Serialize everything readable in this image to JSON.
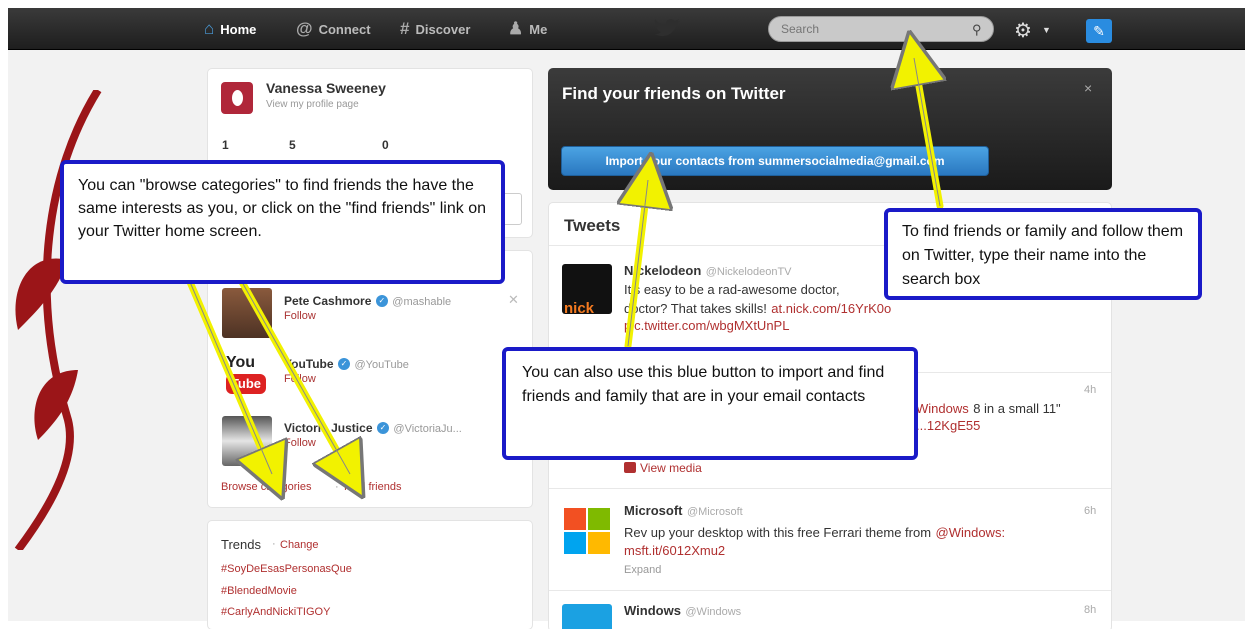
{
  "topbar": {
    "nav": [
      {
        "label": "Home",
        "icon": "home-icon",
        "active": true
      },
      {
        "label": "Connect",
        "icon": "at-icon",
        "active": false
      },
      {
        "label": "Discover",
        "icon": "hash-icon",
        "active": false
      },
      {
        "label": "Me",
        "icon": "person-icon",
        "active": false
      }
    ],
    "search_placeholder": "Search"
  },
  "profile": {
    "name": "Vanessa Sweeney",
    "link": "View my profile page",
    "stats": [
      "1",
      "5",
      "0"
    ]
  },
  "suggestions": [
    {
      "name": "Pete Cashmore",
      "handle": "@mashable",
      "follow": "Follow"
    },
    {
      "name": "YouTube",
      "handle": "@YouTube",
      "follow": "Follow",
      "avatar_text_top": "You",
      "avatar_text_bottom": "Tube"
    },
    {
      "name": "Victoria Justice",
      "handle": "@VictoriaJu...",
      "follow": "Follow"
    }
  ],
  "links": {
    "browse": "Browse categories",
    "separator": "·",
    "find": "Find friends"
  },
  "trends": {
    "title": "Trends",
    "separator": "·",
    "change": "Change",
    "items": [
      "#SoyDeEsasPersonasQue",
      "#BlendedMovie",
      "#CarlyAndNickiTIGOY"
    ]
  },
  "find_friends": {
    "title": "Find your friends on Twitter",
    "button": "Import your contacts from summersocialmedia@gmail.com",
    "close": "×"
  },
  "tweets": {
    "title": "Tweets",
    "items": [
      {
        "name": "Nickelodeon",
        "handle": "@NickelodeonTV",
        "avatar_text": "nick",
        "line1": "It's easy to be a rad-awesome doctor,",
        "line2_text": "doctor? That takes skills!",
        "line2_link": "at.nick.com/16YrK0o",
        "line3_link": "pic.twitter.com/wbgMXtUnPL"
      },
      {
        "time": "4h",
        "text_link": "Windows",
        "text": "8 in a small 11\"",
        "line2_link": "...12KgE55",
        "media": "View media"
      },
      {
        "name": "Microsoft",
        "handle": "@Microsoft",
        "time": "6h",
        "line1_text": "Rev up your desktop with this free Ferrari theme from",
        "line1_link": "@Windows:",
        "line2_link": "msft.it/6012Xmu2",
        "expand": "Expand"
      },
      {
        "name": "Windows",
        "handle": "@Windows",
        "time": "8h"
      }
    ]
  },
  "annotations": {
    "left": "You can \"browse categories\" to find friends the have the same interests as you, or click on the \"find friends\" link on your Twitter home screen.",
    "right": "To find friends or family and follow them on Twitter, type their name into the search box",
    "middle": "You can also use this blue button to import and find friends and family that are in your email contacts"
  },
  "colors": {
    "accent_link": "#b03030",
    "import_button": "#2a78c0",
    "callout_border": "#1a1ac8",
    "arrow": "#f2f200"
  }
}
